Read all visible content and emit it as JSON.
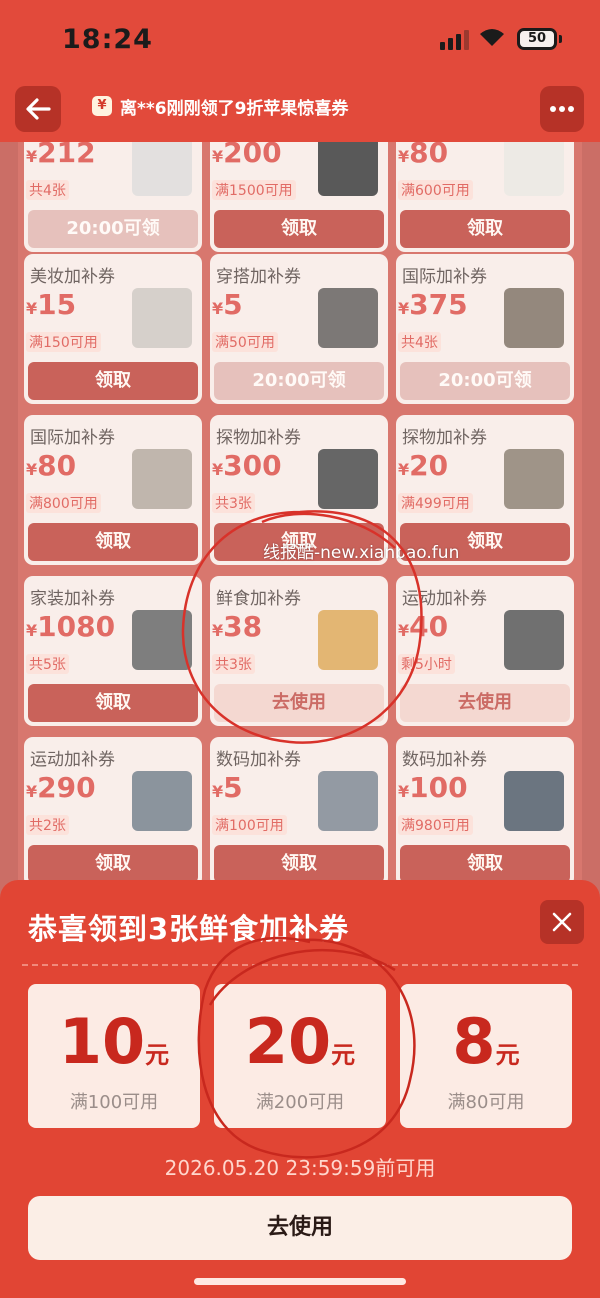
{
  "status": {
    "time": "18:24",
    "battery": "50"
  },
  "nav": {
    "ticker_icon": "¥",
    "ticker": "离**6刚刚领了9折苹果惊喜券",
    "back_icon": "back-arrow-icon",
    "more_icon": "more-dots-icon"
  },
  "cards": [
    {
      "title": "",
      "amount": "212",
      "cond": "共4张",
      "btn": "20:00可领",
      "state": "dim"
    },
    {
      "title": "",
      "amount": "200",
      "cond": "满1500可用",
      "btn": "领取",
      "state": "normal"
    },
    {
      "title": "",
      "amount": "80",
      "cond": "满600可用",
      "btn": "领取",
      "state": "normal"
    },
    {
      "title": "美妆加补券",
      "amount": "15",
      "cond": "满150可用",
      "btn": "领取",
      "state": "normal"
    },
    {
      "title": "穿搭加补券",
      "amount": "5",
      "cond": "满50可用",
      "btn": "20:00可领",
      "state": "dim"
    },
    {
      "title": "国际加补券",
      "amount": "375",
      "cond": "共4张",
      "btn": "20:00可领",
      "state": "dim"
    },
    {
      "title": "国际加补券",
      "amount": "80",
      "cond": "满800可用",
      "btn": "领取",
      "state": "normal"
    },
    {
      "title": "探物加补券",
      "amount": "300",
      "cond": "共3张",
      "btn": "领取",
      "state": "normal"
    },
    {
      "title": "探物加补券",
      "amount": "20",
      "cond": "满499可用",
      "btn": "领取",
      "state": "normal"
    },
    {
      "title": "家装加补券",
      "amount": "1080",
      "cond": "共5张",
      "btn": "领取",
      "state": "normal"
    },
    {
      "title": "鲜食加补券",
      "amount": "38",
      "cond": "共3张",
      "btn": "去使用",
      "state": "light"
    },
    {
      "title": "运动加补券",
      "amount": "40",
      "cond": "剩5小时",
      "btn": "去使用",
      "state": "light"
    },
    {
      "title": "运动加补券",
      "amount": "290",
      "cond": "共2张",
      "btn": "领取",
      "state": "normal"
    },
    {
      "title": "数码加补券",
      "amount": "5",
      "cond": "满100可用",
      "btn": "领取",
      "state": "normal"
    },
    {
      "title": "数码加补券",
      "amount": "100",
      "cond": "满980可用",
      "btn": "领取",
      "state": "normal"
    }
  ],
  "currency": "¥",
  "watermark": "线报酷-new.xianbao.fun",
  "sheet": {
    "title": "恭喜领到3张鲜食加补券",
    "coupons": [
      {
        "value": "10",
        "unit": "元",
        "cond": "满100可用"
      },
      {
        "value": "20",
        "unit": "元",
        "cond": "满200可用"
      },
      {
        "value": "8",
        "unit": "元",
        "cond": "满80可用"
      }
    ],
    "deadline": "2026.05.20 23:59:59前可用",
    "use_label": "去使用"
  }
}
